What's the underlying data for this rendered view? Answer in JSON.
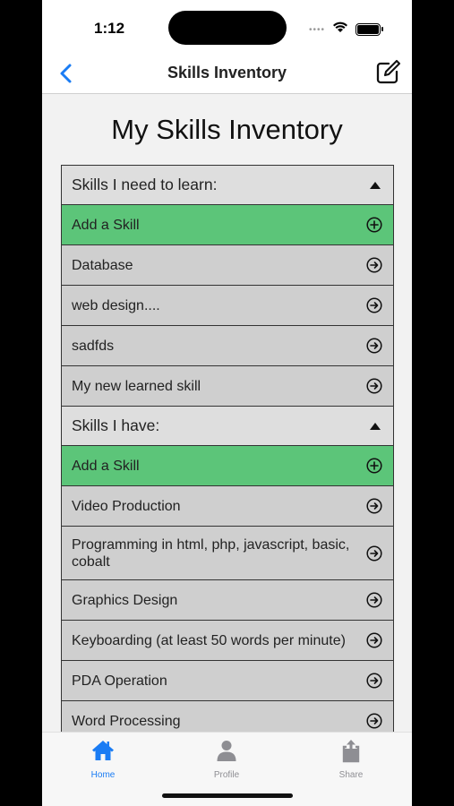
{
  "status": {
    "time": "1:12"
  },
  "nav": {
    "title": "Skills Inventory"
  },
  "page": {
    "title": "My Skills Inventory"
  },
  "sections": [
    {
      "header": "Skills I need to learn:",
      "add_label": "Add a Skill",
      "items": [
        "Database",
        "web design....",
        "sadfds",
        "My new learned skill"
      ]
    },
    {
      "header": "Skills I have:",
      "add_label": "Add a Skill",
      "items": [
        "Video Production",
        "Programming in html, php, javascript, basic, cobalt",
        "Graphics Design",
        "Keyboarding (at least 50 words per minute)",
        "PDA Operation",
        "Word Processing"
      ]
    }
  ],
  "tabs": [
    {
      "label": "Home",
      "icon": "house-icon",
      "active": true
    },
    {
      "label": "Profile",
      "icon": "person-icon",
      "active": false
    },
    {
      "label": "Share",
      "icon": "share-icon",
      "active": false
    }
  ],
  "colors": {
    "accent": "#1a7cf4",
    "add_row": "#5cc579",
    "row": "#cfcfcf",
    "header_row": "#dedede"
  }
}
